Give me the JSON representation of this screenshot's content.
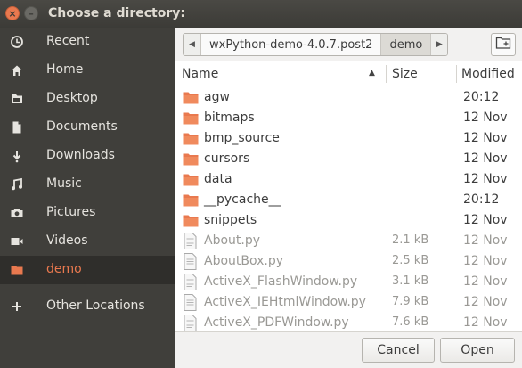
{
  "window": {
    "title": "Choose a directory:"
  },
  "sidebar": {
    "items": [
      {
        "label": "Recent",
        "icon": "clock-icon"
      },
      {
        "label": "Home",
        "icon": "home-icon"
      },
      {
        "label": "Desktop",
        "icon": "desktop-folder-icon"
      },
      {
        "label": "Documents",
        "icon": "document-icon"
      },
      {
        "label": "Downloads",
        "icon": "download-icon"
      },
      {
        "label": "Music",
        "icon": "music-icon"
      },
      {
        "label": "Pictures",
        "icon": "camera-icon"
      },
      {
        "label": "Videos",
        "icon": "video-icon"
      },
      {
        "label": "demo",
        "icon": "folder-icon",
        "active": true
      }
    ],
    "other_locations": "Other Locations"
  },
  "pathbar": {
    "segments": [
      "wxPython-demo-4.0.7.post2",
      "demo"
    ],
    "current": "demo"
  },
  "columns": {
    "name": "Name",
    "size": "Size",
    "modified": "Modified"
  },
  "files": [
    {
      "name": "agw",
      "size": "",
      "modified": "20:12",
      "type": "folder"
    },
    {
      "name": "bitmaps",
      "size": "",
      "modified": "12 Nov",
      "type": "folder"
    },
    {
      "name": "bmp_source",
      "size": "",
      "modified": "12 Nov",
      "type": "folder"
    },
    {
      "name": "cursors",
      "size": "",
      "modified": "12 Nov",
      "type": "folder"
    },
    {
      "name": "data",
      "size": "",
      "modified": "12 Nov",
      "type": "folder"
    },
    {
      "name": "__pycache__",
      "size": "",
      "modified": "20:12",
      "type": "folder"
    },
    {
      "name": "snippets",
      "size": "",
      "modified": "12 Nov",
      "type": "folder"
    },
    {
      "name": "About.py",
      "size": "2.1 kB",
      "modified": "12 Nov",
      "type": "file"
    },
    {
      "name": "AboutBox.py",
      "size": "2.5 kB",
      "modified": "12 Nov",
      "type": "file"
    },
    {
      "name": "ActiveX_FlashWindow.py",
      "size": "3.1 kB",
      "modified": "12 Nov",
      "type": "file"
    },
    {
      "name": "ActiveX_IEHtmlWindow.py",
      "size": "7.9 kB",
      "modified": "12 Nov",
      "type": "file"
    },
    {
      "name": "ActiveX_PDFWindow.py",
      "size": "7.6 kB",
      "modified": "12 Nov",
      "type": "file"
    }
  ],
  "actions": {
    "cancel": "Cancel",
    "open": "Open"
  },
  "colors": {
    "accent": "#e9794f",
    "sidebar_bg": "#403f3b",
    "folder": "#e9794f"
  }
}
